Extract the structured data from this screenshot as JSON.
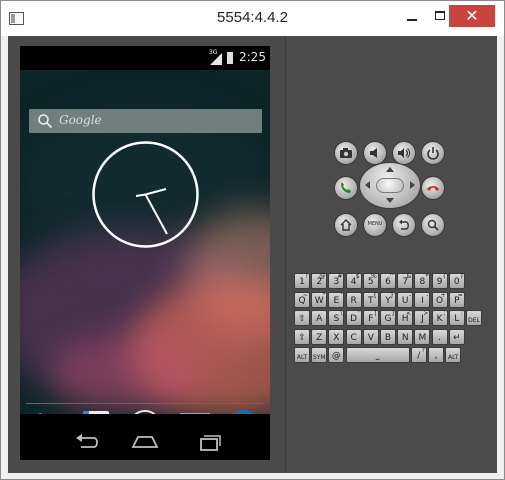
{
  "window": {
    "title": "5554:4.4.2",
    "minimize_label": "",
    "maximize_label": "",
    "close_label": "✕"
  },
  "phone": {
    "status_bar": {
      "network": "3G",
      "time": "2:25"
    },
    "search": {
      "placeholder": "Google"
    },
    "dock": [
      "phone-icon",
      "contacts-icon",
      "apps-icon",
      "messaging-icon",
      "browser-icon"
    ],
    "nav": [
      "back-icon",
      "home-icon",
      "recents-icon"
    ]
  },
  "hardware_buttons": {
    "row1": [
      "camera-icon",
      "volume-down-icon",
      "volume-up-icon",
      "power-icon"
    ],
    "row3_menu_label": "MENU"
  },
  "keyboard": {
    "row1": [
      {
        "key": "1",
        "sup": "!"
      },
      {
        "key": "2",
        "sup": "@"
      },
      {
        "key": "3",
        "sup": "#"
      },
      {
        "key": "4",
        "sup": "$"
      },
      {
        "key": "5",
        "sup": "%"
      },
      {
        "key": "6",
        "sup": "^"
      },
      {
        "key": "7",
        "sup": "&"
      },
      {
        "key": "8",
        "sup": "*"
      },
      {
        "key": "9",
        "sup": "("
      },
      {
        "key": "0",
        "sup": ")"
      }
    ],
    "row2": [
      {
        "key": "Q",
        "sup": "~"
      },
      {
        "key": "W",
        "sup": "\""
      },
      {
        "key": "E",
        "sup": "'"
      },
      {
        "key": "R",
        "sup": ""
      },
      {
        "key": "T",
        "sup": "{"
      },
      {
        "key": "Y",
        "sup": "}"
      },
      {
        "key": "U",
        "sup": "-"
      },
      {
        "key": "I",
        "sup": "-"
      },
      {
        "key": "O",
        "sup": "+"
      },
      {
        "key": "P",
        "sup": "="
      }
    ],
    "row3": [
      {
        "key": "⇧",
        "sup": ""
      },
      {
        "key": "A",
        "sup": ""
      },
      {
        "key": "S",
        "sup": "\\"
      },
      {
        "key": "D",
        "sup": "'"
      },
      {
        "key": "F",
        "sup": "["
      },
      {
        "key": "G",
        "sup": "]"
      },
      {
        "key": "H",
        "sup": "<"
      },
      {
        "key": "J",
        "sup": ">"
      },
      {
        "key": "K",
        "sup": ";"
      },
      {
        "key": "L",
        "sup": ":"
      },
      {
        "key": "DEL",
        "sup": ""
      }
    ],
    "row4": [
      {
        "key": "⇧",
        "sup": ""
      },
      {
        "key": "Z",
        "sup": ""
      },
      {
        "key": "X",
        "sup": ""
      },
      {
        "key": "C",
        "sup": ""
      },
      {
        "key": "V",
        "sup": ""
      },
      {
        "key": "B",
        "sup": ""
      },
      {
        "key": "N",
        "sup": ""
      },
      {
        "key": "M",
        "sup": ""
      },
      {
        "key": ".",
        "sup": ""
      },
      {
        "key": "↵",
        "sup": ""
      }
    ],
    "row5": [
      {
        "key": "ALT",
        "sup": ""
      },
      {
        "key": "SYM",
        "sup": ""
      },
      {
        "key": "@",
        "sup": ""
      },
      {
        "key": "⎵",
        "sup": ""
      },
      {
        "key": "/",
        "sup": "?"
      },
      {
        "key": ",",
        "sup": ""
      },
      {
        "key": "ALT",
        "sup": ""
      }
    ]
  }
}
